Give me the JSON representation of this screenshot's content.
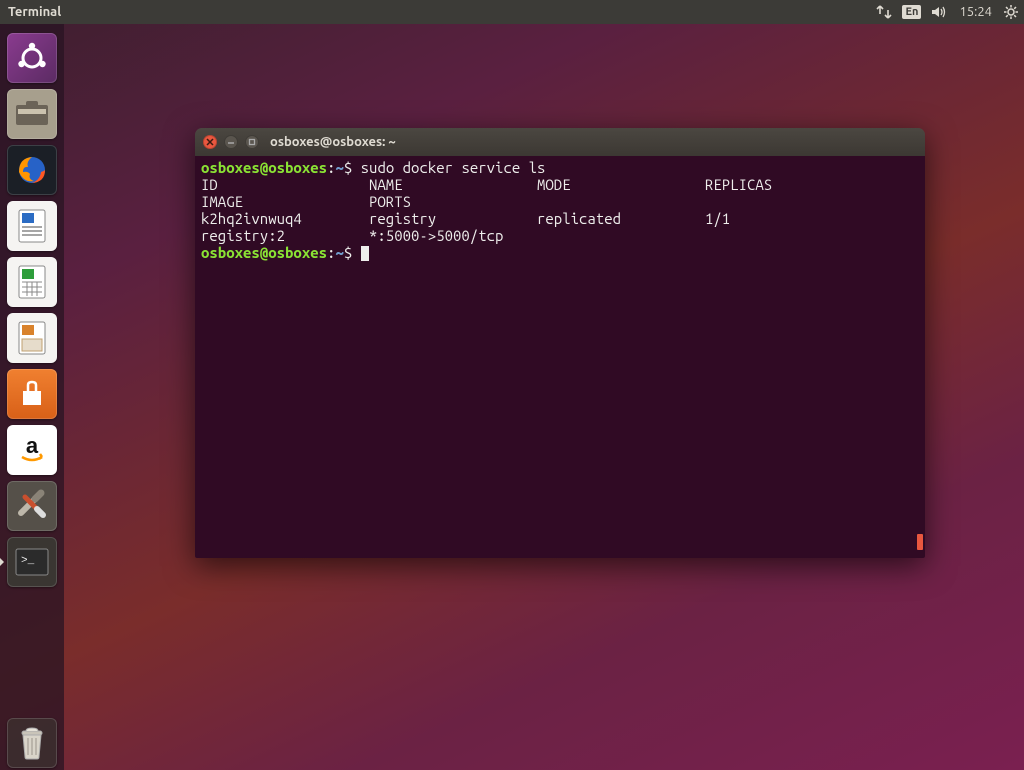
{
  "top_panel": {
    "app_label": "Terminal",
    "language_indicator": "En",
    "clock": "15:24"
  },
  "launcher": {
    "dash": "dash",
    "files": "files",
    "firefox": "firefox",
    "writer": "writer",
    "calc": "calc",
    "impress": "impress",
    "software": "software",
    "amazon": "amazon",
    "settings": "settings",
    "terminal": "terminal",
    "trash": "trash"
  },
  "window": {
    "title": "osboxes@osboxes: ~"
  },
  "terminal": {
    "prompt_user": "osboxes",
    "prompt_at": "@",
    "prompt_host": "osboxes",
    "prompt_colon": ":",
    "prompt_path": "~",
    "prompt_dollar": "$ ",
    "command1": "sudo docker service ls",
    "header_line1": "ID                  NAME                MODE                REPLICAS            ",
    "header_line2": "IMAGE               PORTS",
    "row_line1": "k2hq2ivnwuq4        registry            replicated          1/1                 ",
    "row_line2": "registry:2          *:5000->5000/tcp"
  }
}
